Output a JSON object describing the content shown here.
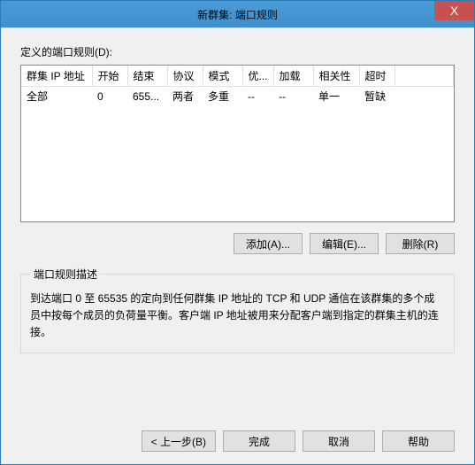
{
  "titlebar": {
    "title": "新群集: 端口规则",
    "close": "X"
  },
  "rules": {
    "label": "定义的端口规则(D):",
    "headers": {
      "ip": "群集 IP 地址",
      "start": "开始",
      "end": "结束",
      "protocol": "协议",
      "mode": "模式",
      "priority": "优...",
      "load": "加载",
      "affinity": "相关性",
      "timeout": "超时"
    },
    "rows": [
      {
        "ip": "全部",
        "start": "0",
        "end": "655...",
        "protocol": "两者",
        "mode": "多重",
        "priority": "--",
        "load": "--",
        "affinity": "单一",
        "timeout": "暂缺"
      }
    ]
  },
  "buttons": {
    "add": "添加(A)...",
    "edit": "编辑(E)...",
    "remove": "删除(R)"
  },
  "description": {
    "legend": "端口规则描述",
    "text": "到达端口 0 至 65535 的定向到任何群集 IP 地址的 TCP 和 UDP 通信在该群集的多个成员中按每个成员的负荷量平衡。客户端 IP 地址被用来分配客户端到指定的群集主机的连接。"
  },
  "footer": {
    "back": "< 上一步(B)",
    "finish": "完成",
    "cancel": "取消",
    "help": "帮助"
  }
}
